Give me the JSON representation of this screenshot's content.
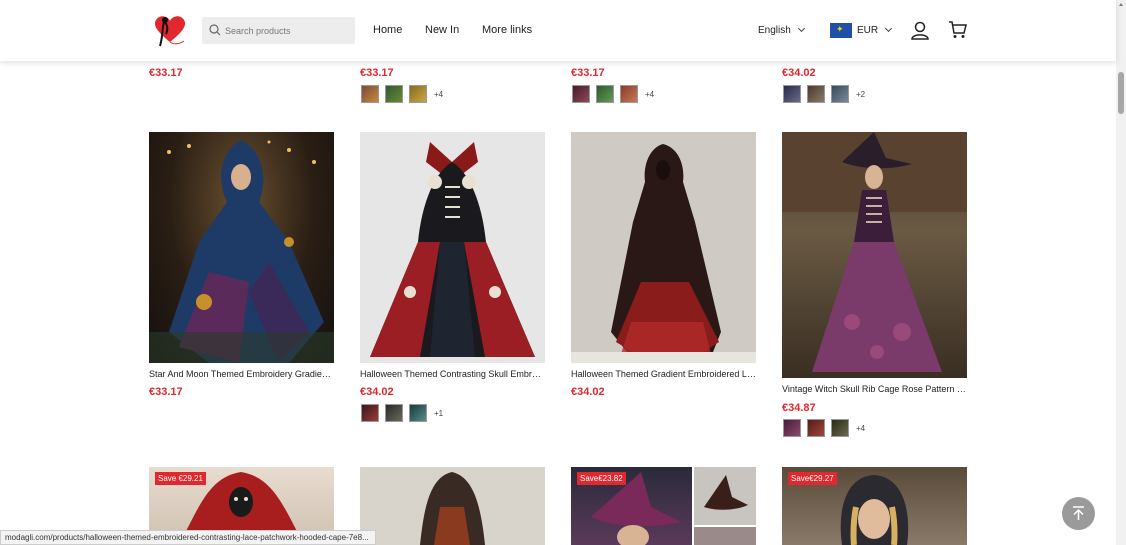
{
  "header": {
    "search_placeholder": "Search products",
    "nav": [
      "Home",
      "New In",
      "More links"
    ],
    "language": "English",
    "currency": "EUR"
  },
  "colors": {
    "accent": "#e0282e",
    "header_bg": "#ffffff"
  },
  "top_row": [
    {
      "price": "€33.17",
      "swatch_colors": [],
      "more": ""
    },
    {
      "price": "€33.17",
      "swatch_colors": [
        "#7b4a3a",
        "#3f6b3a",
        "#9a7a2a"
      ],
      "more": "+4"
    },
    {
      "price": "€33.17",
      "swatch_colors": [
        "#5a2a3a",
        "#3a6a3a",
        "#a85a3a"
      ],
      "more": "+4"
    },
    {
      "price": "€34.02",
      "swatch_colors": [
        "#3a3a5a",
        "#5a4a3a",
        "#4a5a6a"
      ],
      "more": "+2"
    }
  ],
  "products": [
    {
      "title": "Star And Moon Themed Embroidery Gradient Hooded Dress",
      "price": "€33.17",
      "swatch_colors": [],
      "more": ""
    },
    {
      "title": "Halloween Themed Contrasting Skull Embroidered Dress",
      "price": "€34.02",
      "swatch_colors": [
        "#5a2a2a",
        "#3a3a3a",
        "#2a4a4a"
      ],
      "more": "+1"
    },
    {
      "title": "Halloween Themed Gradient Embroidered Long Dress",
      "price": "€34.02",
      "swatch_colors": [],
      "more": ""
    },
    {
      "title": "Vintage Witch Skull Rib Cage Rose Pattern Dress",
      "price": "€34.87",
      "swatch_colors": [
        "#5a2a4a",
        "#7a2a2a",
        "#3a3a2a"
      ],
      "more": "+4"
    }
  ],
  "bottom_row": [
    {
      "badge": "Save €29.21"
    },
    {
      "badge": ""
    },
    {
      "badge": "Save€23.82"
    },
    {
      "badge": "Save€29.27"
    }
  ],
  "status_url": "modagli.com/products/halloween-themed-embroidered-contrasting-lace-patchwork-hooded-cape-7e8..."
}
